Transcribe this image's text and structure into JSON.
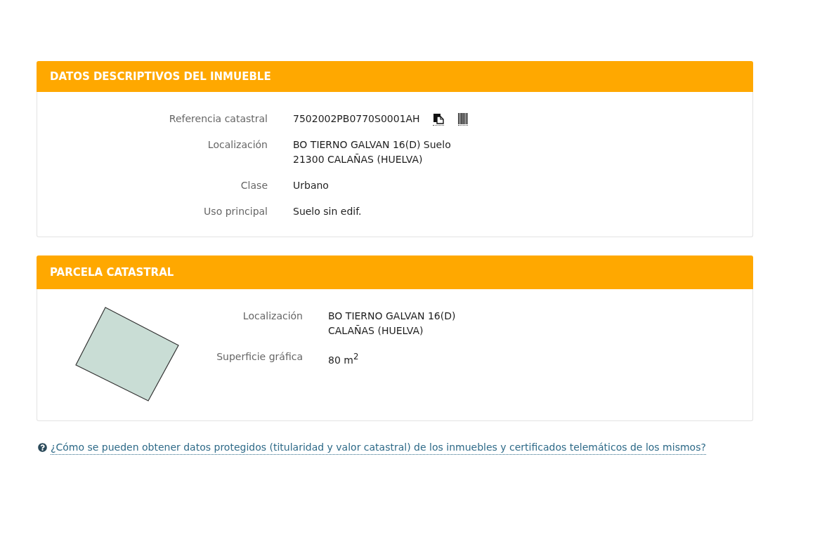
{
  "sections": [
    {
      "kind": "details",
      "title": "DATOS DESCRIPTIVOS DEL INMUEBLE",
      "fields": [
        {
          "kind": "reference",
          "label": "Referencia catastral",
          "lines": [
            "7502002PB0770S0001AH"
          ]
        },
        {
          "kind": "text",
          "label": "Localización",
          "lines": [
            "BO TIERNO GALVAN 16(D) Suelo",
            "21300 CALAÑAS (HUELVA)"
          ]
        },
        {
          "kind": "text",
          "label": "Clase",
          "lines": [
            "Urbano"
          ]
        },
        {
          "kind": "text",
          "label": "Uso principal",
          "lines": [
            "Suelo sin edif."
          ]
        }
      ]
    },
    {
      "kind": "parcel",
      "title": "PARCELA CATASTRAL",
      "fields": [
        {
          "kind": "text",
          "label": "Localización",
          "lines": [
            "BO TIERNO GALVAN 16(D)",
            "CALAÑAS (HUELVA)"
          ]
        },
        {
          "kind": "text",
          "label": "Superficie gráfica",
          "lines": [
            "80 m$^{2}$"
          ]
        }
      ]
    }
  ],
  "help_link": "¿Cómo se pueden obtener datos protegidos (titularidad y valor catastral) de los inmuebles y certificados telemáticos de los mismos?"
}
